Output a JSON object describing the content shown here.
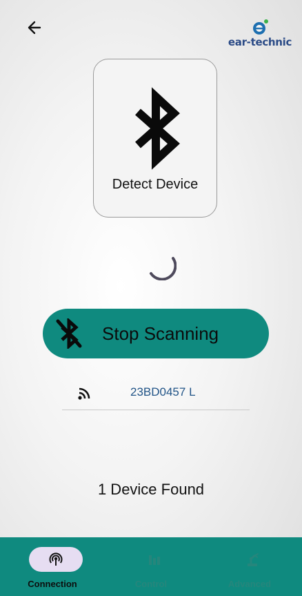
{
  "header": {
    "back_icon": "arrow-left-icon",
    "logo_text": "ear-technic"
  },
  "detect_card": {
    "icon": "bluetooth-icon",
    "label": "Detect Device"
  },
  "scan_button": {
    "icon": "bluetooth-off-icon",
    "label": "Stop Scanning"
  },
  "device_list": [
    {
      "icon": "signal-icon",
      "name": "23BD0457 L"
    }
  ],
  "status": {
    "found_text": "1 Device Found"
  },
  "bottom_nav": {
    "items": [
      {
        "label": "Connection",
        "icon": "broadcast-icon",
        "active": true
      },
      {
        "label": "Control",
        "icon": "equalizer-icon",
        "active": false
      },
      {
        "label": "Advanced",
        "icon": "robot-arm-icon",
        "active": false
      }
    ]
  },
  "colors": {
    "accent": "#0f8a7f",
    "active_pill": "#e6ddf2",
    "device_name": "#215487",
    "logo": "#2a4a86"
  }
}
